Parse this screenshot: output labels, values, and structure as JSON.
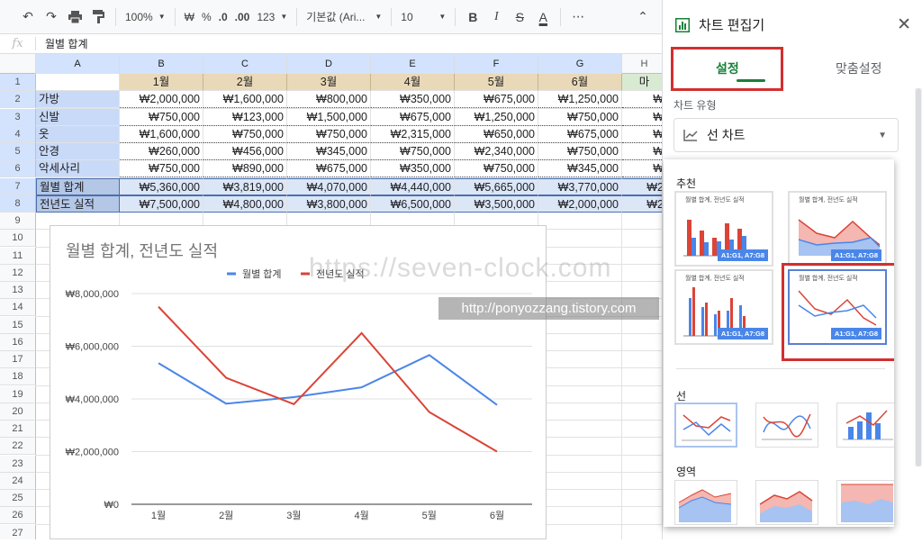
{
  "toolbar": {
    "zoom": "100%",
    "currency": "₩",
    "percent": "%",
    "dec_less": ".0",
    "dec_more": ".00",
    "more_formats": "123",
    "font": "기본값 (Ari...",
    "font_size": "10",
    "bold": "B",
    "italic": "I",
    "strike": "S",
    "text_color": "A",
    "more": "⋯"
  },
  "formula_bar": {
    "fx": "fx",
    "value": "월별 합계"
  },
  "sheet": {
    "columns": [
      "A",
      "B",
      "C",
      "D",
      "E",
      "F",
      "G",
      "H"
    ],
    "rows": [
      "1",
      "2",
      "3",
      "4",
      "5",
      "6",
      "7",
      "8",
      "9",
      "10",
      "11",
      "12",
      "13",
      "14",
      "15",
      "16",
      "17",
      "18",
      "19",
      "20",
      "21",
      "22",
      "23",
      "24",
      "25",
      "26",
      "27"
    ],
    "header_row": [
      "",
      "1월",
      "2월",
      "3월",
      "4월",
      "5월",
      "6월",
      "마"
    ],
    "data": [
      {
        "label": "가방",
        "values": [
          "₩2,000,000",
          "₩1,600,000",
          "₩800,000",
          "₩350,000",
          "₩675,000",
          "₩1,250,000",
          "₩"
        ]
      },
      {
        "label": "신발",
        "values": [
          "₩750,000",
          "₩123,000",
          "₩1,500,000",
          "₩675,000",
          "₩1,250,000",
          "₩750,000",
          "₩"
        ]
      },
      {
        "label": "옷",
        "values": [
          "₩1,600,000",
          "₩750,000",
          "₩750,000",
          "₩2,315,000",
          "₩650,000",
          "₩675,000",
          "₩"
        ]
      },
      {
        "label": "안경",
        "values": [
          "₩260,000",
          "₩456,000",
          "₩345,000",
          "₩750,000",
          "₩2,340,000",
          "₩750,000",
          "₩"
        ]
      },
      {
        "label": "악세사리",
        "values": [
          "₩750,000",
          "₩890,000",
          "₩675,000",
          "₩350,000",
          "₩750,000",
          "₩345,000",
          "₩"
        ]
      },
      {
        "label": "월별 합계",
        "values": [
          "₩5,360,000",
          "₩3,819,000",
          "₩4,070,000",
          "₩4,440,000",
          "₩5,665,000",
          "₩3,770,000",
          "₩2"
        ]
      },
      {
        "label": "전년도 실적",
        "values": [
          "₩7,500,000",
          "₩4,800,000",
          "₩3,800,000",
          "₩6,500,000",
          "₩3,500,000",
          "₩2,000,000",
          "₩2"
        ]
      }
    ]
  },
  "chart_data": {
    "type": "line",
    "title": "월별 합계, 전년도 실적",
    "categories": [
      "1월",
      "2월",
      "3월",
      "4월",
      "5월",
      "6월"
    ],
    "series": [
      {
        "name": "월별 합계",
        "color": "#4a86e8",
        "values": [
          5360000,
          3819000,
          4070000,
          4440000,
          5665000,
          3770000
        ]
      },
      {
        "name": "전년도 실적",
        "color": "#db4437",
        "values": [
          7500000,
          4800000,
          3800000,
          6500000,
          3500000,
          2000000
        ]
      }
    ],
    "ylim": [
      0,
      8000000
    ],
    "yticks": [
      "₩0",
      "₩2,000,000",
      "₩4,000,000",
      "₩6,000,000",
      "₩8,000,000"
    ],
    "legend": "top",
    "grid": true
  },
  "editor": {
    "title": "차트 편집기",
    "tab_setup": "설정",
    "tab_customize": "맞춤설정",
    "chart_type_label": "차트 유형",
    "chart_type_value": "선 차트",
    "section_recommended": "추천",
    "section_line": "선",
    "section_area": "영역",
    "thumb_title": "월별 합계, 전년도 실적",
    "thumb_range": "A1:G1, A7:G8"
  },
  "watermark": {
    "text1": "https://seven-clock.com",
    "text2": "http://ponyozzang.tistory.com"
  }
}
